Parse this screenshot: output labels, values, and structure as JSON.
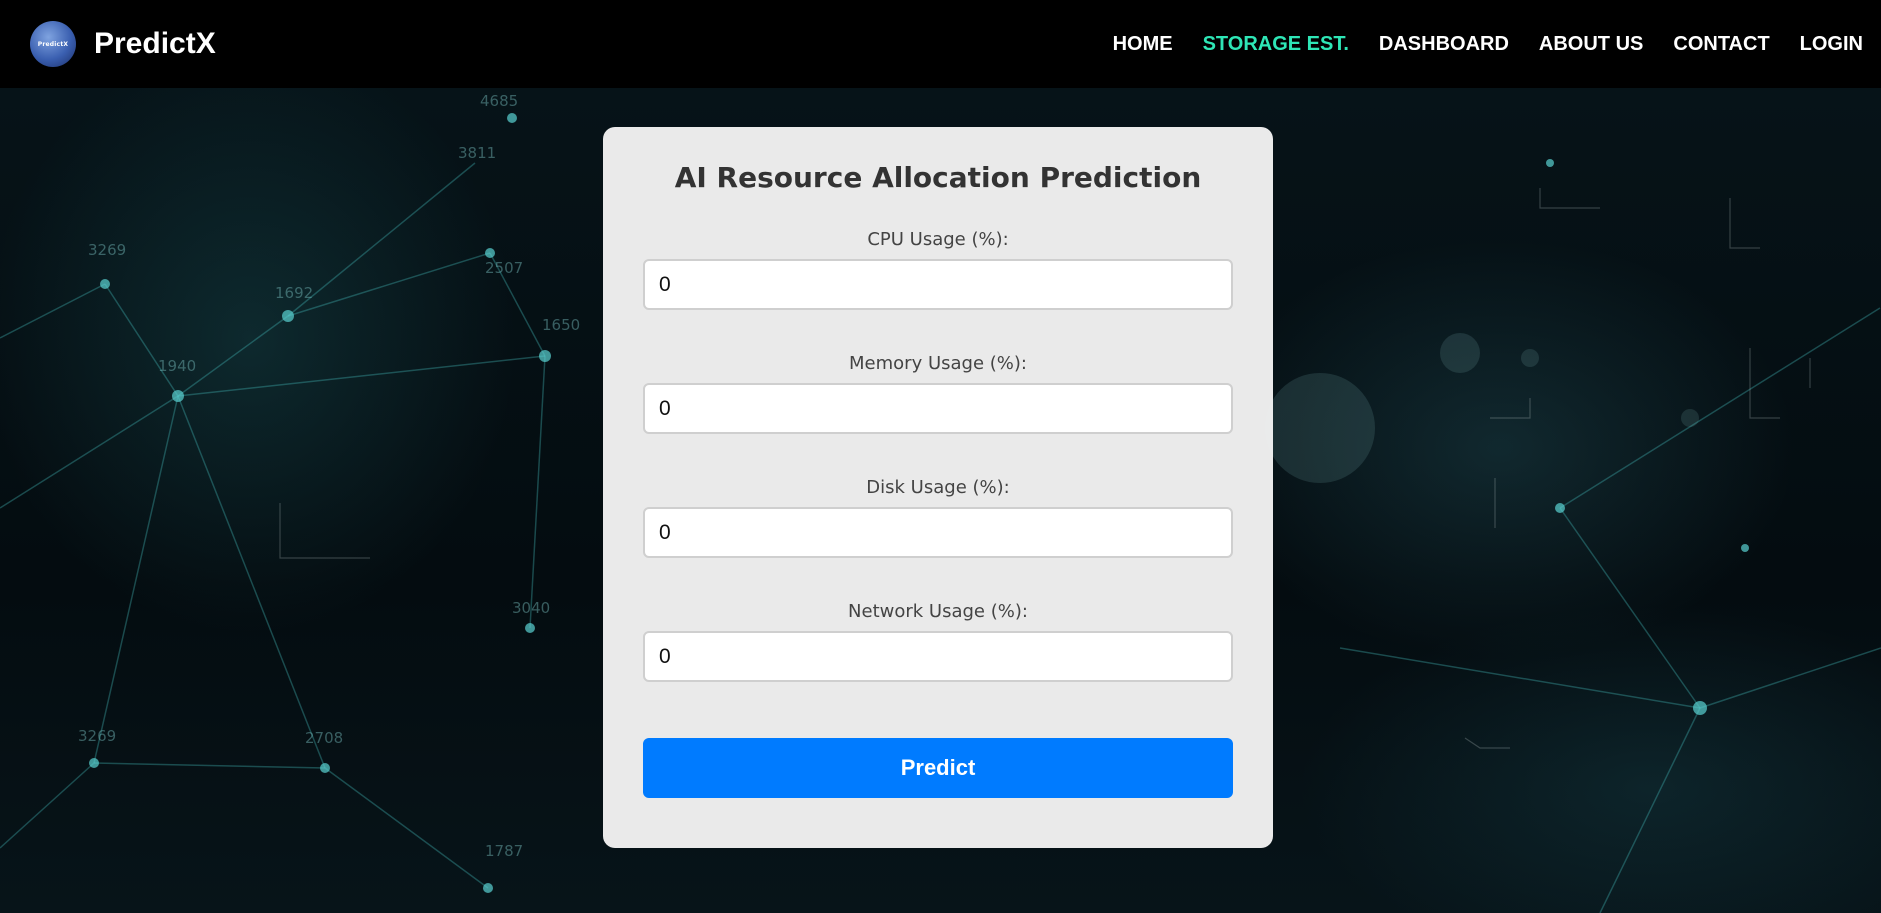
{
  "brand": {
    "name": "PredictX",
    "logo_text": "PredictX"
  },
  "nav": {
    "items": [
      {
        "label": "HOME",
        "active": false
      },
      {
        "label": "STORAGE EST.",
        "active": true
      },
      {
        "label": "DASHBOARD",
        "active": false
      },
      {
        "label": "ABOUT US",
        "active": false
      },
      {
        "label": "CONTACT",
        "active": false
      },
      {
        "label": "LOGIN",
        "active": false
      }
    ]
  },
  "form": {
    "title": "AI Resource Allocation Prediction",
    "fields": [
      {
        "label": "CPU Usage (%):",
        "value": "0"
      },
      {
        "label": "Memory Usage (%):",
        "value": "0"
      },
      {
        "label": "Disk Usage (%):",
        "value": "0"
      },
      {
        "label": "Network Usage (%):",
        "value": "0"
      }
    ],
    "submit_label": "Predict"
  },
  "background_labels": [
    "3269",
    "1940",
    "3811",
    "2507",
    "1650",
    "3269",
    "2708",
    "3040",
    "1787",
    "4685",
    "1692"
  ],
  "colors": {
    "navbar_bg": "#000000",
    "nav_active": "#2ee6b6",
    "button_primary": "#007bff",
    "card_bg": "#f2f2f2"
  }
}
